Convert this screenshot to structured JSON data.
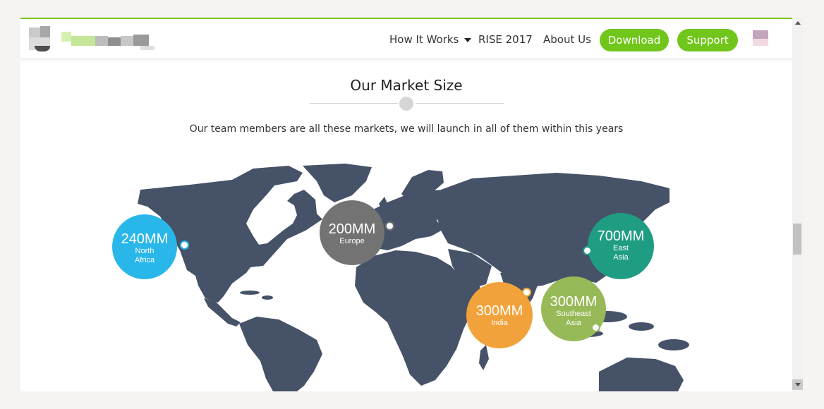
{
  "nav": {
    "how_it_works": "How It Works",
    "rise": "RISE 2017",
    "about": "About Us",
    "download": "Download",
    "support": "Support",
    "dropdown_icon": "caret-down-icon"
  },
  "section": {
    "title": "Our Market Size",
    "subtitle": "Our team members are all these markets, we will launch in all of them within this years"
  },
  "colors": {
    "accent_green": "#71c61b",
    "map": "#465268",
    "north_america": "#29b7ea",
    "europe": "#737373",
    "east_asia": "#1f9d82",
    "india": "#f2a23a",
    "southeast_asia": "#97b957"
  },
  "markets": [
    {
      "amount": "240MM",
      "region": [
        "North",
        "Africa"
      ]
    },
    {
      "amount": "200MM",
      "region": [
        "Europe"
      ]
    },
    {
      "amount": "700MM",
      "region": [
        "East",
        "Asia"
      ]
    },
    {
      "amount": "300MM",
      "region": [
        "India"
      ]
    },
    {
      "amount": "300MM",
      "region": [
        "Southeast",
        "Asia"
      ]
    }
  ]
}
